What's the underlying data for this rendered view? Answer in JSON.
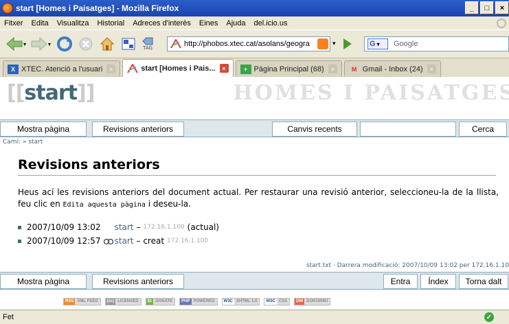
{
  "window": {
    "title": "start [Homes i Paisatges] - Mozilla Firefox",
    "minimize": "_",
    "maximize": "□",
    "close": "×"
  },
  "menu": [
    "Fitxer",
    "Edita",
    "Visualitza",
    "Historial",
    "Adreces d'interès",
    "Eines",
    "Ajuda",
    "del.icio.us"
  ],
  "nav": {
    "url": "http://phobos.xtec.cat/asolans/geogra",
    "tag_label": "TAG",
    "search_placeholder": "Google",
    "search_engine_label": "G"
  },
  "tabs": [
    {
      "label": "XTEC. Atenció a l'usuari",
      "icon": "xtec-icon",
      "active": false
    },
    {
      "label": "start [Homes i Pais...",
      "icon": "dokuwiki-icon",
      "active": true
    },
    {
      "label": "Pàgina Principal (68)",
      "icon": "plus-icon",
      "active": false
    },
    {
      "label": "Gmail - Inbox (24)",
      "icon": "gmail-icon",
      "active": false
    }
  ],
  "wiki": {
    "title_open": "[[",
    "title": "start",
    "title_close": "]]",
    "site_name": "HOMES I PAISATGES",
    "toolbar_top": {
      "show_page": "Mostra pàgina",
      "old_revisions": "Revisions anteriors",
      "recent_changes": "Canvis recents",
      "search_value": "",
      "search_button": "Cerca"
    },
    "breadcrumbs": "Camí: » start",
    "heading": "Revisions anteriors",
    "intro_part1": "Heus ací les revisions anteriors del document actual. Per restaurar una revisió anterior, seleccioneu-la de la llista, feu clic en ",
    "intro_code": "Edita aquesta pàgina",
    "intro_part2": " i deseu-la.",
    "revisions": [
      {
        "date": "2007/10/09 13:02",
        "link": "start",
        "sep": "–",
        "ip": "172.16.1.100",
        "note": "(actual)"
      },
      {
        "date": "2007/10/09 12:57",
        "link": "start",
        "sep": "– creat",
        "ip": "172.16.1.100",
        "note": ""
      }
    ],
    "docinfo": "start.txt · Darrera modificació: 2007/10/09 13:02 per 172.16.1.10",
    "toolbar_bottom": {
      "show_page": "Mostra pàgina",
      "old_revisions": "Revisions anteriors",
      "login": "Entra",
      "index": "Índex",
      "top": "Torna dalt"
    },
    "badges": [
      {
        "l": "RSS",
        "r": "XML FEED"
      },
      {
        "l": "(cc)",
        "r": "LICENSED"
      },
      {
        "l": "$1",
        "r": "DONATE"
      },
      {
        "l": "PHP",
        "r": "POWERED"
      },
      {
        "l": "W3C",
        "r": "XHTML 1.0"
      },
      {
        "l": "W3C",
        "r": "CSS"
      },
      {
        "l": "DW",
        "r": "DOKUWIKI"
      }
    ]
  },
  "status": {
    "text": "Fet"
  },
  "colors": {
    "wiki_accent": "#436976",
    "toolbar_bg": "#dee7ec",
    "titlebar": "#2b5ec9"
  }
}
